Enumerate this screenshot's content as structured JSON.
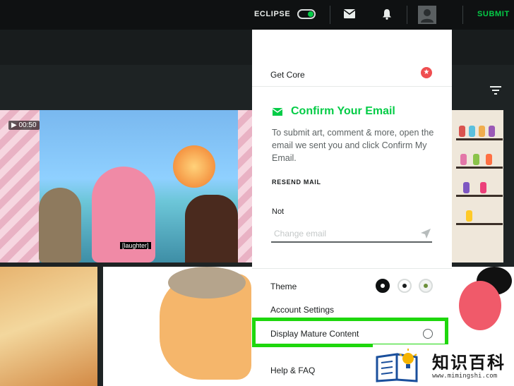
{
  "topbar": {
    "eclipse_label": "ECLIPSE",
    "eclipse_toggle_on": true,
    "submit_label": "SUBMIT",
    "icons": [
      "mail-icon",
      "bell-icon",
      "avatar-icon",
      "filter-icon"
    ]
  },
  "thumbnails": {
    "video_duration": "00:50",
    "video_caption": "[laughter]"
  },
  "menu": {
    "get_core_label": "Get Core",
    "confirm_email": {
      "title": "Confirm Your Email",
      "description": "To submit art, comment & more, open the email we sent you and click Confirm My Email.",
      "resend_label": "RESEND MAIL",
      "not_label": "Not",
      "change_email_placeholder": "Change email"
    },
    "theme_label": "Theme",
    "theme_options": [
      "dark",
      "light",
      "green"
    ],
    "account_settings_label": "Account Settings",
    "mature_content_label": "Display Mature Content",
    "mature_content_enabled": false,
    "help_label": "Help & FAQ"
  },
  "watermark": {
    "chinese": "知识百科",
    "url": "www.mimingshi.com"
  },
  "colors": {
    "accent": "#05cc47",
    "highlight": "#1ed70d",
    "topbar_bg": "#0f1112",
    "core_red": "#ef4e50"
  }
}
